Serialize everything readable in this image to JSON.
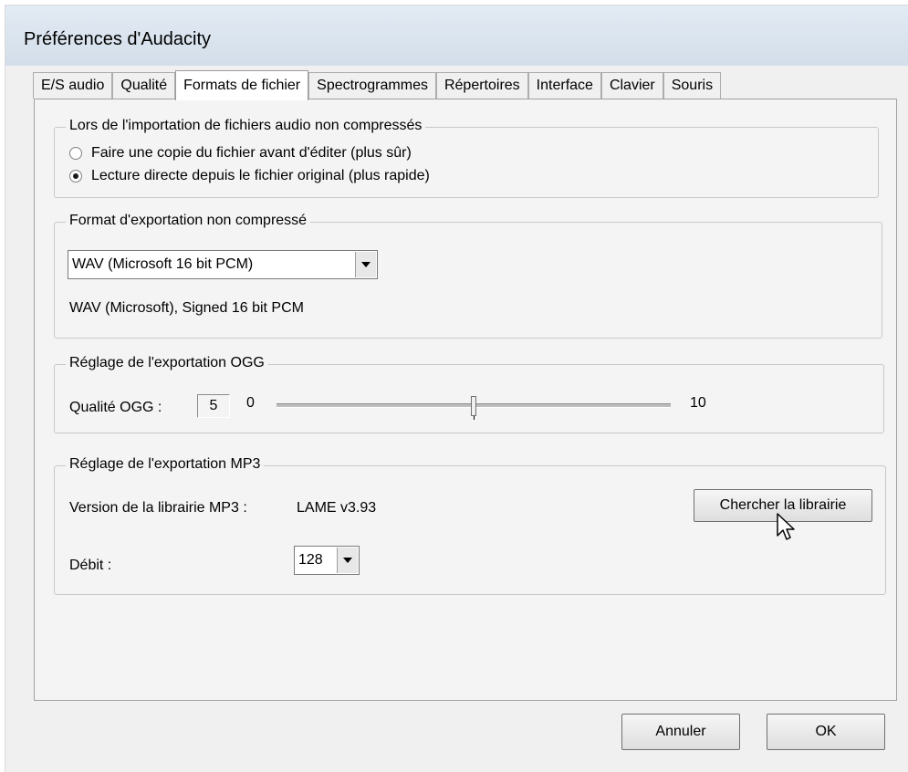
{
  "window": {
    "title": "Préférences d'Audacity"
  },
  "tabs": [
    {
      "label": "E/S audio",
      "active": false
    },
    {
      "label": "Qualité",
      "active": false
    },
    {
      "label": "Formats de fichier",
      "active": true
    },
    {
      "label": "Spectrogrammes",
      "active": false
    },
    {
      "label": "Répertoires",
      "active": false
    },
    {
      "label": "Interface",
      "active": false
    },
    {
      "label": "Clavier",
      "active": false
    },
    {
      "label": "Souris",
      "active": false
    }
  ],
  "import_group": {
    "legend": "Lors de l'importation de fichiers audio non compressés",
    "options": [
      {
        "label": "Faire une copie du fichier avant d'éditer (plus sûr)",
        "checked": false
      },
      {
        "label": "Lecture directe depuis le fichier original (plus rapide)",
        "checked": true
      }
    ]
  },
  "export_group": {
    "legend": "Format d'exportation non compressé",
    "format_selected": "WAV (Microsoft 16 bit PCM)",
    "format_description": "WAV (Microsoft), Signed 16 bit PCM"
  },
  "ogg_group": {
    "legend": "Réglage de l'exportation OGG",
    "quality_label": "Qualité OGG :",
    "quality_value": "5",
    "min_label": "0",
    "max_label": "10",
    "slider_min": 0,
    "slider_max": 10,
    "slider_value": 5
  },
  "mp3_group": {
    "legend": "Réglage de l'exportation MP3",
    "version_label": "Version de la librairie MP3 :",
    "version_value": "LAME v3.93",
    "find_library_button": "Chercher la librairie",
    "bitrate_label": "Débit :",
    "bitrate_selected": "128"
  },
  "footer": {
    "cancel_button": "Annuler",
    "ok_button": "OK"
  }
}
